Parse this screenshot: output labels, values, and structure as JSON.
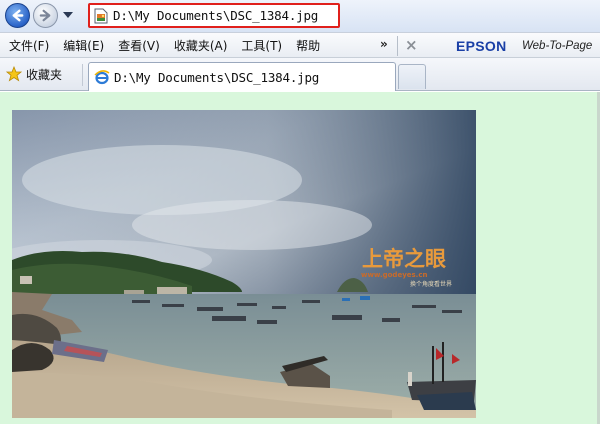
{
  "address": {
    "url": "D:\\My Documents\\DSC_1384.jpg"
  },
  "menu": {
    "items": [
      {
        "label": "文件(F)"
      },
      {
        "label": "编辑(E)"
      },
      {
        "label": "查看(V)"
      },
      {
        "label": "收藏夹(A)"
      },
      {
        "label": "工具(T)"
      },
      {
        "label": "帮助"
      }
    ],
    "more": "»",
    "close": "×"
  },
  "toolbar": {
    "brand": "EPSON",
    "brand_product": "Web-To-Page"
  },
  "favorites": {
    "label": "收藏夹"
  },
  "tab": {
    "title": "D:\\My Documents\\DSC_1384.jpg"
  },
  "image": {
    "watermark_title": "上帝之眼",
    "watermark_url": "www.godeyes.cn",
    "watermark_sub": "换个角度看世界"
  },
  "colors": {
    "content_bg": "#d9f7dc",
    "address_highlight": "#e0201c",
    "brand": "#1a3fa6"
  }
}
